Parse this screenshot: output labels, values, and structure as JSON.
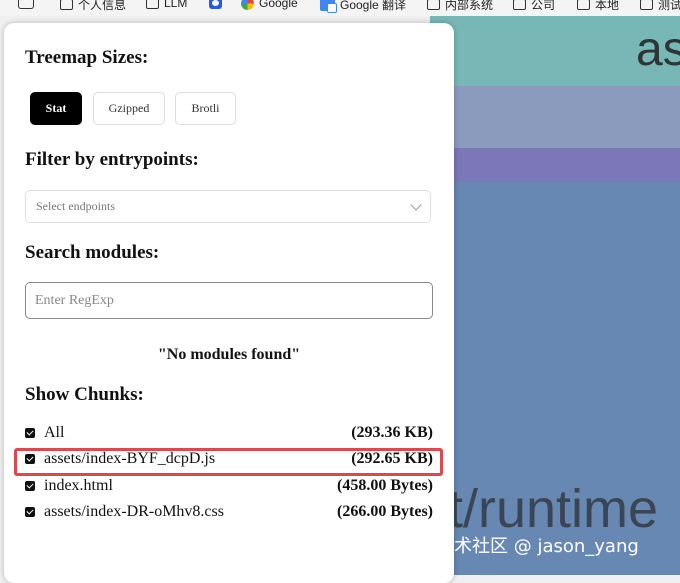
{
  "bookmarks": [
    {
      "label": "个人信息",
      "icon": "folder-icon"
    },
    {
      "label": "LLM",
      "icon": "folder-icon"
    },
    {
      "label": "",
      "icon": "baidu-icon"
    },
    {
      "label": "Google",
      "icon": "google-icon"
    },
    {
      "label": "Google 翻译",
      "icon": "google-translate-icon"
    },
    {
      "label": "内部系统",
      "icon": "folder-icon"
    },
    {
      "label": "公司",
      "icon": "folder-icon"
    },
    {
      "label": "本地",
      "icon": "folder-icon"
    },
    {
      "label": "测试",
      "icon": "folder-icon"
    }
  ],
  "treemap": {
    "top_label": "as",
    "main_label": "t/runtime"
  },
  "watermark": "掘金技术社区 @ jason_yang",
  "sidebar": {
    "sizes_heading": "Treemap Sizes:",
    "size_buttons": [
      "Stat",
      "Gzipped",
      "Brotli"
    ],
    "selected_size": "Stat",
    "filter_heading": "Filter by entrypoints:",
    "filter_placeholder": "Select endpoints",
    "search_heading": "Search modules:",
    "search_placeholder": "Enter RegExp",
    "search_result": "\"No modules found\"",
    "chunks_heading": "Show Chunks:",
    "chunks": [
      {
        "name": "All",
        "size": "(293.36 KB)",
        "checked": true
      },
      {
        "name": "assets/index-BYF_dcpD.js",
        "size": "(292.65 KB)",
        "checked": true,
        "highlighted": true
      },
      {
        "name": "index.html",
        "size": "(458.00 Bytes)",
        "checked": true
      },
      {
        "name": "assets/index-DR-oMhv8.css",
        "size": "(266.00 Bytes)",
        "checked": true
      }
    ]
  },
  "colors": {
    "treemap_teal": "#77b8b6",
    "treemap_blue": "#6788b2",
    "treemap_purple": "#7c77b7",
    "highlight_red": "#e0474c"
  }
}
